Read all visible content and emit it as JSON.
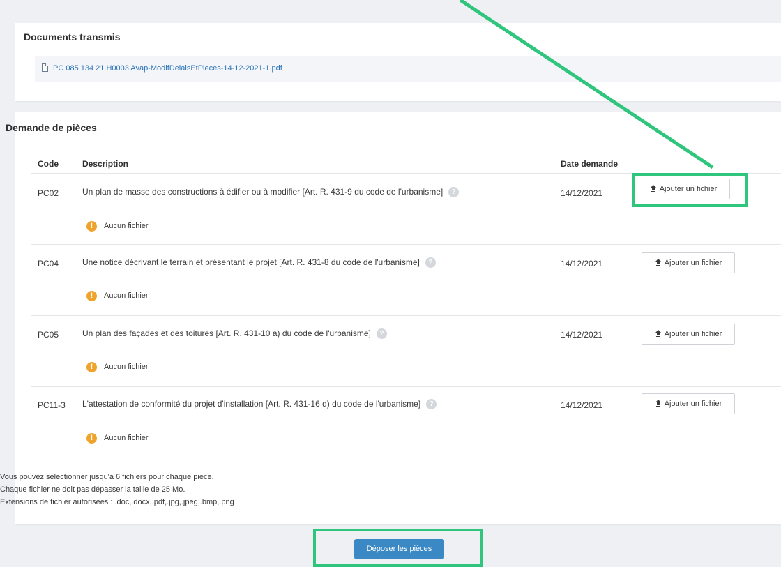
{
  "documents": {
    "title": "Documents transmis",
    "file_link": "PC 085 134 21 H0003 Avap-ModifDelaisEtPieces-14-12-2021-1.pdf"
  },
  "pieces": {
    "title": "Demande de pièces",
    "headers": {
      "code": "Code",
      "description": "Description",
      "date": "Date demande"
    },
    "rows": [
      {
        "code": "PC02",
        "description": "Un plan de masse des constructions à édifier ou à modifier [Art. R. 431-9 du code de l'urbanisme]",
        "date": "14/12/2021",
        "button": "Ajouter un fichier",
        "status": "Aucun fichier"
      },
      {
        "code": "PC04",
        "description": "Une notice décrivant le terrain et présentant le projet [Art. R. 431-8 du code de l'urbanisme]",
        "date": "14/12/2021",
        "button": "Ajouter un fichier",
        "status": "Aucun fichier"
      },
      {
        "code": "PC05",
        "description": "Un plan des façades et des toitures [Art. R. 431-10 a) du code de l'urbanisme]",
        "date": "14/12/2021",
        "button": "Ajouter un fichier",
        "status": "Aucun fichier"
      },
      {
        "code": "PC11-3",
        "description": "L'attestation de conformité du projet d'installation [Art. R. 431-16 d) du code de l'urbanisme]",
        "date": "14/12/2021",
        "button": "Ajouter un fichier",
        "status": "Aucun fichier"
      }
    ],
    "info_lines": [
      "Vous pouvez sélectionner jusqu'à 6 fichiers pour chaque pièce.",
      "Chaque fichier ne doit pas dépasser la taille de 25 Mo.",
      "Extensions de fichier autorisées : .doc,.docx,.pdf,.jpg,.jpeg,.bmp,.png"
    ]
  },
  "submit_label": "Déposer les pièces",
  "colors": {
    "accent": "#3a88c4",
    "highlight": "#2fc57c",
    "warning": "#f0a32b",
    "link": "#2a73b8"
  }
}
